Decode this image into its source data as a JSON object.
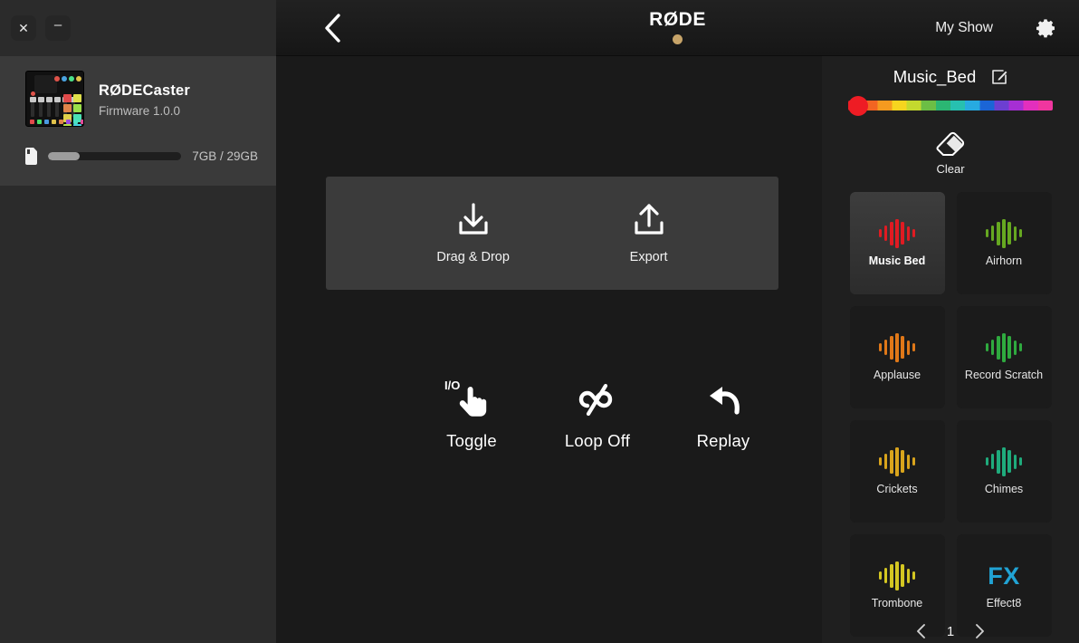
{
  "window": {
    "close_label": "✕",
    "minimize_label": "–"
  },
  "sidebar": {
    "device": {
      "name": "RØDECaster",
      "firmware": "Firmware 1.0.0",
      "thumbnail_icon": "rodecaster-device-image"
    },
    "storage": {
      "icon": "sd-card-icon",
      "used_text": "7GB / 29GB",
      "percent": 24
    }
  },
  "header": {
    "back_icon": "chevron-left-icon",
    "brand": "RØDE",
    "brand_dot_color": "#c7a469",
    "show_name": "My Show",
    "settings_icon": "gear-icon"
  },
  "center": {
    "dropzone": [
      {
        "icon": "download-tray-icon",
        "label": "Drag & Drop"
      },
      {
        "icon": "upload-tray-icon",
        "label": "Export"
      }
    ],
    "actions": [
      {
        "icon": "toggle-hand-io-icon",
        "label": "Toggle"
      },
      {
        "icon": "loop-off-icon",
        "label": "Loop Off"
      },
      {
        "icon": "replay-arrow-icon",
        "label": "Replay"
      }
    ]
  },
  "pads_panel": {
    "title": "Music_Bed",
    "edit_icon": "edit-pencil-icon",
    "color_slider": {
      "selected_color": "#ee1c24",
      "knob_position_percent": 0,
      "stops": [
        "#ee1c24",
        "#f26522",
        "#f59a1f",
        "#f6d51f",
        "#c4d92e",
        "#6cbe45",
        "#2bb673",
        "#27c0b0",
        "#27aae1",
        "#1b65d6",
        "#6c3fd1",
        "#a62fd4",
        "#e32fbd",
        "#f0369f"
      ]
    },
    "clear": {
      "icon": "eraser-icon",
      "label": "Clear"
    },
    "pads": [
      {
        "label": "Music Bed",
        "icon": "waveform-icon",
        "color": "#e01b22",
        "selected": true
      },
      {
        "label": "Airhorn",
        "icon": "waveform-icon",
        "color": "#66a821",
        "selected": false
      },
      {
        "label": "Applause",
        "icon": "waveform-icon",
        "color": "#e07818",
        "selected": false
      },
      {
        "label": "Record Scratch",
        "icon": "waveform-icon",
        "color": "#2faa3f",
        "selected": false
      },
      {
        "label": "Crickets",
        "icon": "waveform-icon",
        "color": "#d9a41c",
        "selected": false
      },
      {
        "label": "Chimes",
        "icon": "waveform-icon",
        "color": "#1fab7c",
        "selected": false
      },
      {
        "label": "Trombone",
        "icon": "waveform-icon",
        "color": "#d4c722",
        "selected": false
      },
      {
        "label": "Effect8",
        "icon": "fx-text-icon",
        "color": "#21a3d4",
        "selected": false,
        "glyph": "FX"
      }
    ],
    "pager": {
      "prev_icon": "chevron-left-icon",
      "next_icon": "chevron-right-icon",
      "page": "1"
    }
  }
}
